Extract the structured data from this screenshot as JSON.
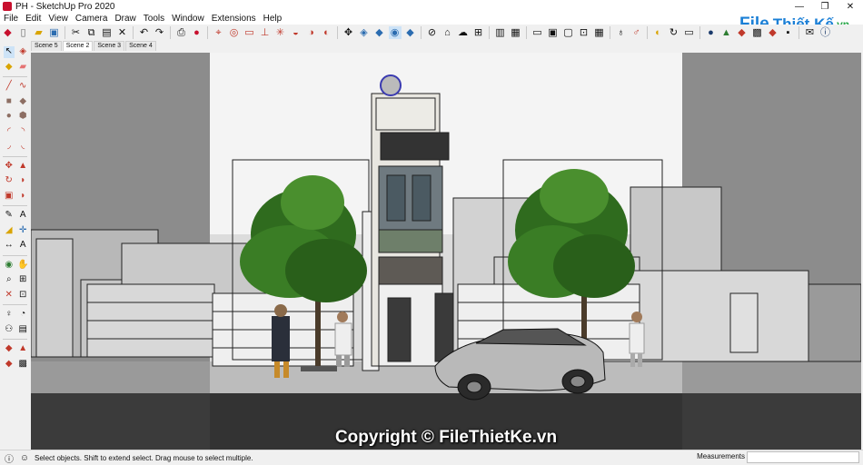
{
  "window": {
    "title": "PH - SketchUp Pro 2020",
    "minimize": "—",
    "restore": "❐",
    "close": "✕"
  },
  "menu": [
    "File",
    "Edit",
    "View",
    "Camera",
    "Draw",
    "Tools",
    "Window",
    "Extensions",
    "Help"
  ],
  "logo": {
    "part1": "File",
    "part2": "Thiết Kế",
    "part3": ".vn"
  },
  "scenes": [
    "Scene 5",
    "Scene 2",
    "Scene 3",
    "Scene 4"
  ],
  "active_scene": "Scene 2",
  "toolbar_icons": [
    "getting-started-icon",
    "new-icon",
    "open-icon",
    "save-icon",
    "cut-icon",
    "copy-icon",
    "paste-icon",
    "erase-icon",
    "undo-icon",
    "redo-icon",
    "print-icon",
    "model-info-icon",
    "select-icon",
    "paint-icon",
    "eraser-icon",
    "rectangle-icon",
    "line-icon",
    "circle-icon",
    "arc-icon",
    "push-pull-icon",
    "move-icon",
    "rotate-icon",
    "scale-icon",
    "orbit-icon",
    "pan-icon",
    "zoom-icon",
    "zoom-extents-icon",
    "x-ray-icon",
    "back-edges-icon",
    "wireframe-icon",
    "hidden-line-icon",
    "shaded-icon",
    "textured-icon",
    "monochrome-icon",
    "iso-icon",
    "top-icon",
    "front-icon",
    "right-icon",
    "back-icon",
    "left-icon",
    "section-plane-icon",
    "display-section-icon",
    "3d-warehouse-icon",
    "extension-warehouse-icon",
    "layout-icon",
    "ruby-icon",
    "mail-icon",
    "info-icon"
  ],
  "status": {
    "message": "Select objects. Shift to extend select. Drag mouse to select multiple.",
    "measurements_label": "Measurements",
    "measurements_value": ""
  },
  "watermark": "Copyright © FileThietKe.vn"
}
